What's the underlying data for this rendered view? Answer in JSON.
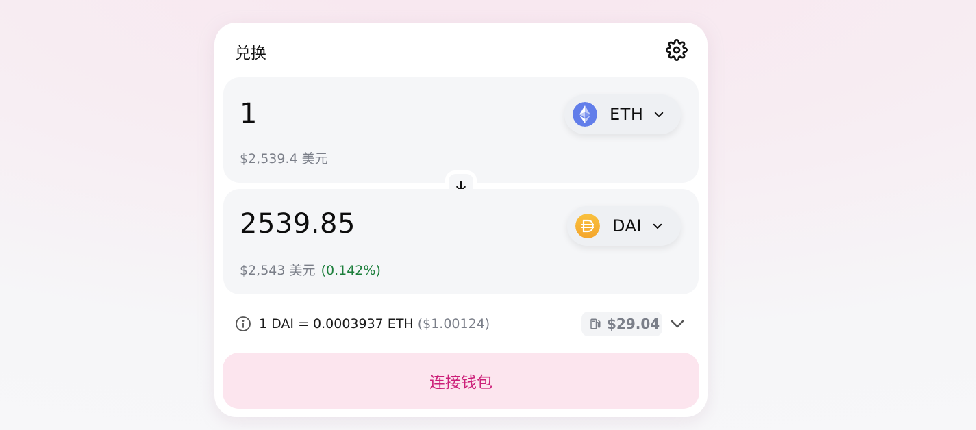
{
  "swap": {
    "title": "兑换"
  },
  "from": {
    "amount": "1",
    "usd_value": "$2,539.4 美元",
    "token": {
      "symbol": "ETH",
      "icon": "ethereum-logo",
      "color": "#627EEA"
    }
  },
  "to": {
    "amount": "2539.85",
    "usd_value": "$2,543 美元",
    "usd_delta": "(0.142%)",
    "token": {
      "symbol": "DAI",
      "icon": "dai-logo",
      "color": "#F5AC37"
    }
  },
  "rate": {
    "text": "1 DAI = 0.0003937 ETH",
    "usd": "($1.00124)"
  },
  "gas": {
    "value": "$29.04",
    "icon": "gas-pump-icon"
  },
  "connect": {
    "label": "连接钱包"
  },
  "colors": {
    "accent": "#CC1E78",
    "accent_bg": "#FCE5EE",
    "positive": "#1D7F3C",
    "muted_text": "#7B7F89",
    "panel_bg": "#F5F6F8"
  },
  "icons": {
    "settings": "gear-icon",
    "switch": "arrow-down-icon",
    "info": "info-icon",
    "chevron": "chevron-down-icon"
  }
}
